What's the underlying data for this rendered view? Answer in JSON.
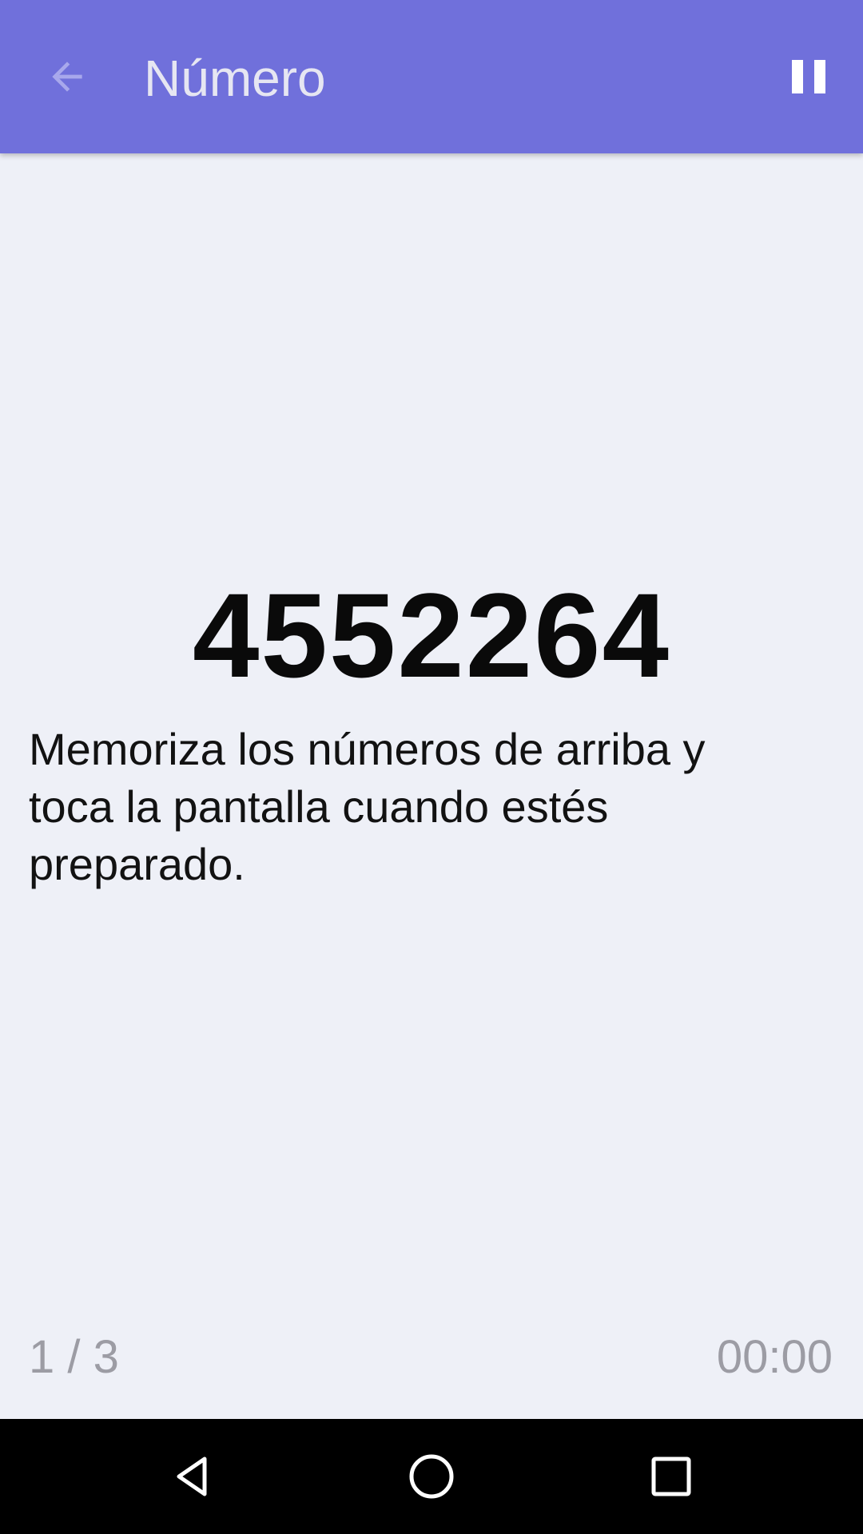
{
  "app_bar": {
    "title": "Número",
    "back_icon": "arrow-back-icon",
    "pause_icon": "pause-icon",
    "background_color": "#7070db"
  },
  "game": {
    "number": "4552264",
    "instruction": "Memoriza los números de arriba y toca la pantalla cuando estés preparado.",
    "progress": "1 / 3",
    "timer": "00:00"
  },
  "nav_bar": {
    "back_icon": "nav-back-icon",
    "home_icon": "nav-home-icon",
    "recents_icon": "nav-recents-icon"
  }
}
